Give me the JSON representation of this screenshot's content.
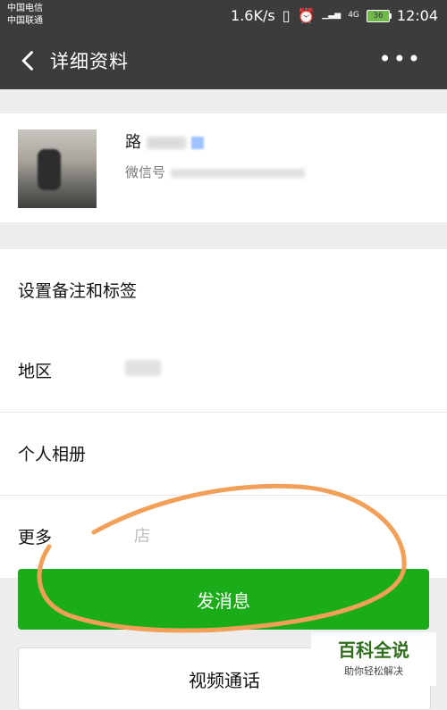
{
  "status_bar": {
    "carrier1": "中国电信",
    "carrier2": "中国联通",
    "speed": "1.6K/s",
    "battery": "36",
    "time": "12:04"
  },
  "nav": {
    "title": "详细资料"
  },
  "profile": {
    "name_prefix": "路",
    "wechat_id_label": "微信号"
  },
  "rows": {
    "remark": "设置备注和标签",
    "region": "地区",
    "album": "个人相册",
    "more": "更多",
    "more_value": "店"
  },
  "buttons": {
    "send_message": "发消息",
    "video_call": "视频通话"
  },
  "watermark": {
    "title": "百科全说",
    "subtitle": "助你轻松解决"
  },
  "colors": {
    "header_bg": "#3c3c3c",
    "accent_green": "#1aad19",
    "annotation_orange": "#f29f58"
  }
}
